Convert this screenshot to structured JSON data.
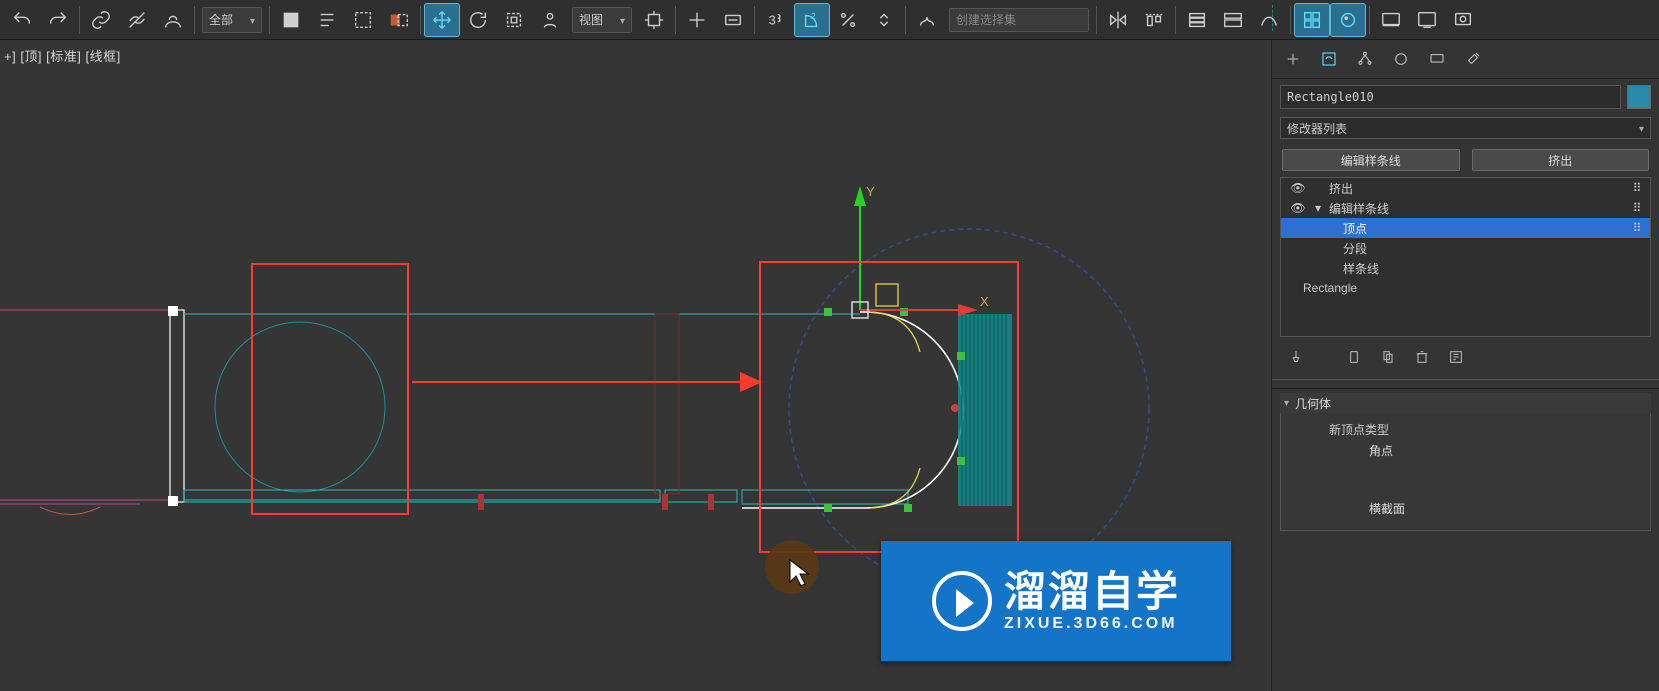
{
  "toolbar": {
    "scope_dropdown": "全部",
    "coord_dropdown": "视图",
    "selection_set_placeholder": "创建选择集"
  },
  "viewport": {
    "label": "+] [顶] [标准] [线框]",
    "axis": {
      "x": "X",
      "y": "Y"
    }
  },
  "panel": {
    "object_name": "Rectangle010",
    "modifier_list_label": "修改器列表",
    "quick_buttons": {
      "edit_spline": "编辑样条线",
      "extrude": "挤出"
    },
    "stack": {
      "items": [
        {
          "label": "挤出",
          "eye": "👁",
          "has_knob": true
        },
        {
          "label": "编辑样条线",
          "eye": "👁",
          "expandable": true,
          "has_knob": true
        },
        {
          "label": "顶点",
          "sub": true,
          "selected": true,
          "has_knob": true
        },
        {
          "label": "分段",
          "sub": true
        },
        {
          "label": "样条线",
          "sub": true
        },
        {
          "label": "Rectangle"
        }
      ]
    },
    "rollouts": {
      "geometry": {
        "title": "几何体",
        "new_vertex_type": "新顶点类型",
        "corner": "角点",
        "crosssection": "横截面"
      }
    }
  },
  "watermark": {
    "title": "溜溜自学",
    "subtitle": "ZIXUE.3D66.COM"
  }
}
